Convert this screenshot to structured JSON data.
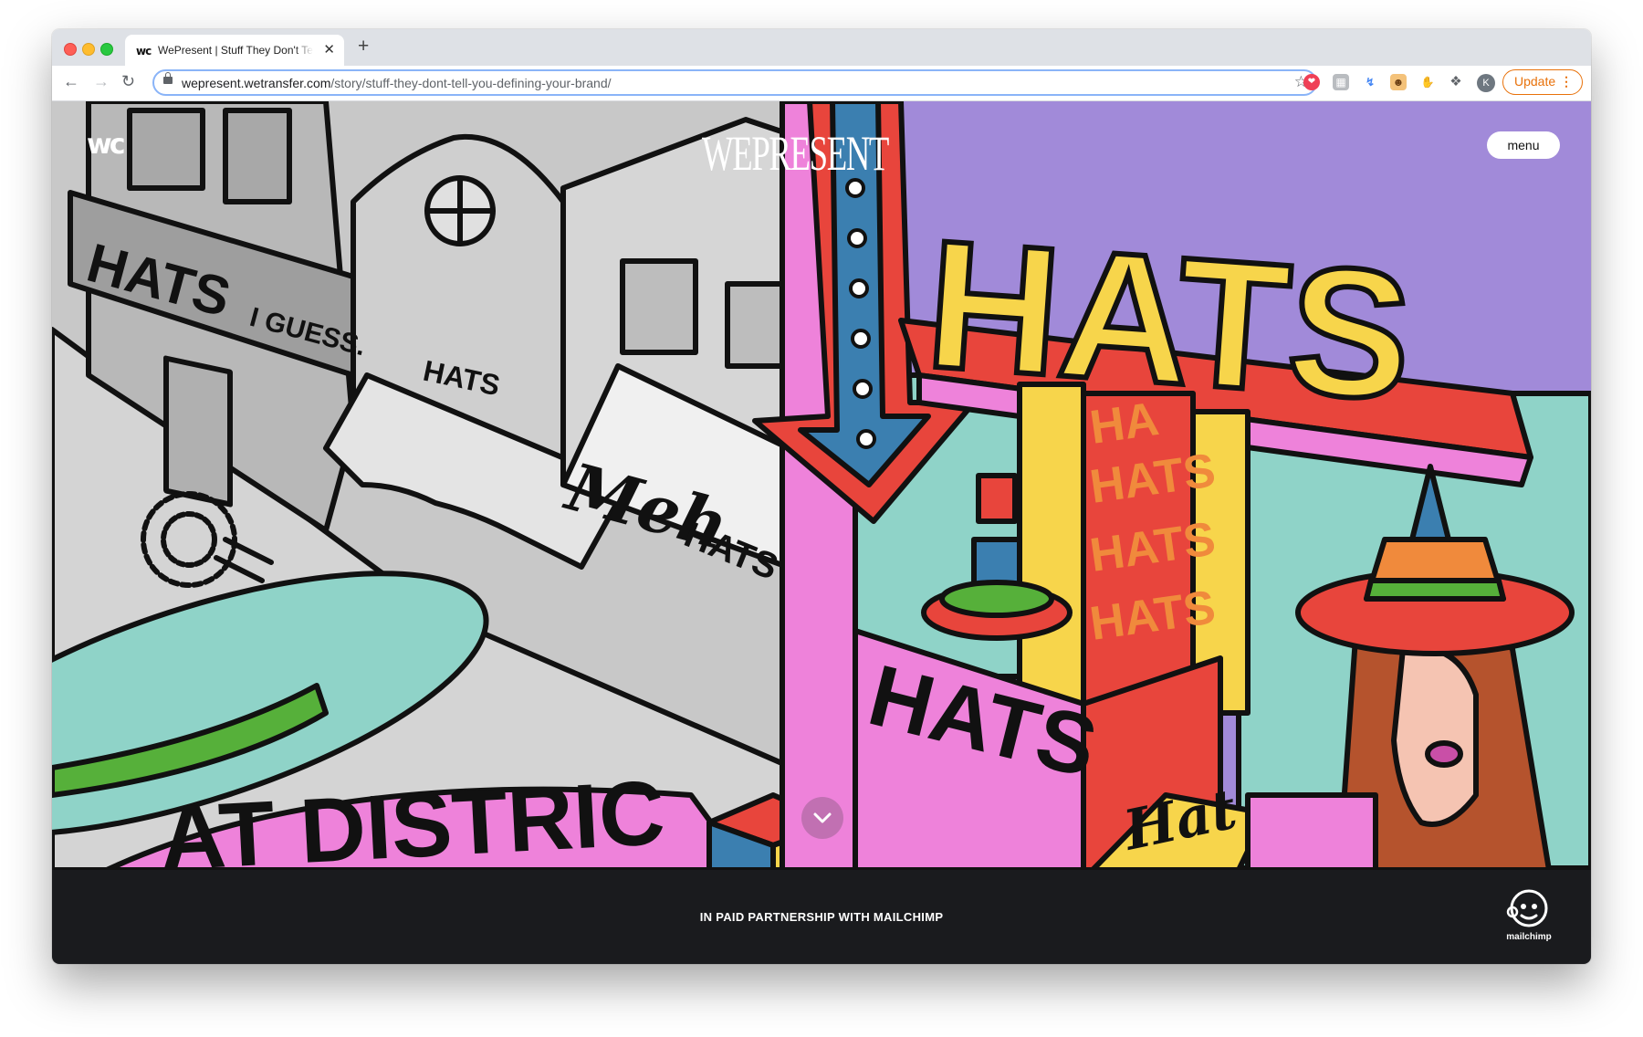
{
  "browser": {
    "tab_title": "WePresent | Stuff They Don't Tell You",
    "tab_favicon": "wc",
    "url_host": "wepresent.wetransfer.com",
    "url_path": "/story/stuff-they-dont-tell-you-defining-your-brand/",
    "new_tab": "+",
    "close": "✕",
    "profile_initial": "K",
    "update_label": "Update",
    "update_dots": "⋮"
  },
  "site": {
    "logo": "wc",
    "brand": "WEPRESENT",
    "menu_label": "menu"
  },
  "illustration": {
    "hats_sign": "HATS",
    "hats_i_guess": "HATS",
    "i_guess": "I GUESS.",
    "gray_hats": "HATS",
    "meh": "Meh",
    "meh_hats": "HATS",
    "window_lines": [
      "HA",
      "HATS",
      "HATS",
      "HATS"
    ],
    "booth_hats": "HATS",
    "hat_script": "Hat",
    "district": "AT DISTRIC"
  },
  "footer": {
    "partnership": "IN PAID PARTNERSHIP WITH MAILCHIMP",
    "mailchimp": "mailchimp"
  },
  "colors": {
    "pink": "#ee82da",
    "purple": "#a18ad9",
    "teal": "#8fd3c8",
    "yellow": "#f7d54b",
    "red": "#e8453c",
    "orange": "#f08a3c",
    "blue": "#3b7fb0",
    "green": "#56b03a",
    "gray": "#c8c8c8",
    "footer_bg": "#1a1b1e"
  }
}
